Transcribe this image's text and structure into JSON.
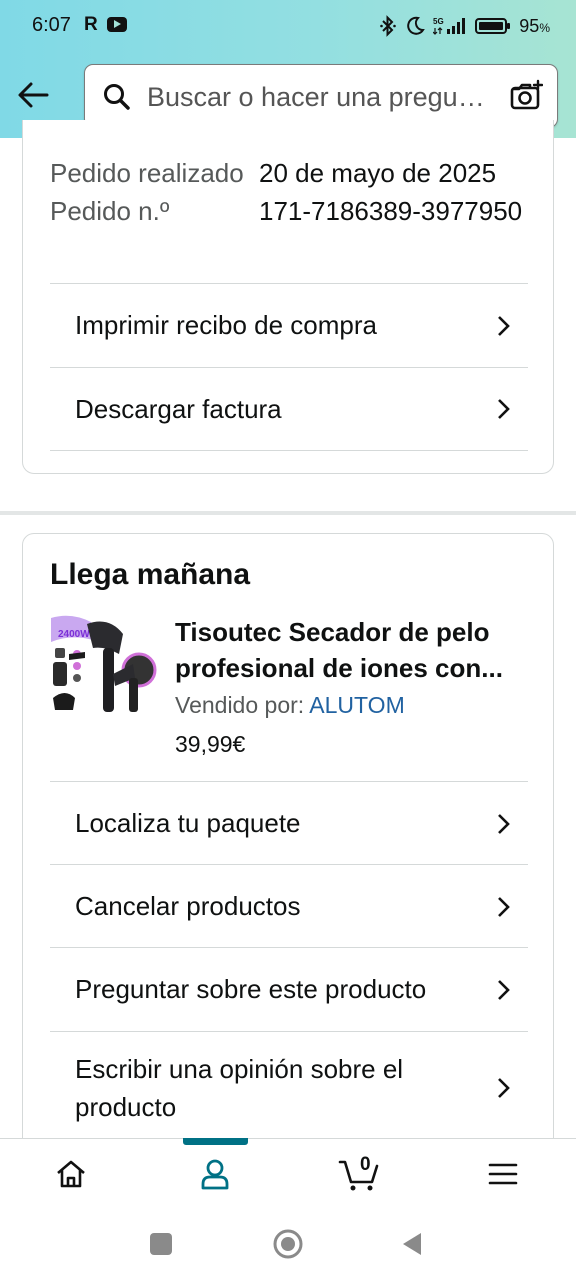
{
  "status_bar": {
    "time": "6:07",
    "carrier_icon": "R",
    "network": "5G",
    "battery_pct": "95",
    "battery_unit": "%"
  },
  "search": {
    "placeholder": "Buscar o hacer una pregunta"
  },
  "order": {
    "placed_label": "Pedido realizado",
    "placed_value": "20 de mayo de 2025",
    "number_label": "Pedido n.º",
    "number_value": "171-7186389-3977950",
    "actions": [
      "Imprimir recibo de compra",
      "Descargar factura"
    ]
  },
  "delivery": {
    "title": "Llega mañana",
    "product": {
      "name_line1": "Tisoutec Secador de pelo",
      "name_line2": "profesional de iones con...",
      "seller_label": "Vendido por:",
      "seller_name": "ALUTOM",
      "price": "39,99€",
      "image_text": "2400W"
    },
    "actions": [
      "Localiza tu paquete",
      "Cancelar productos",
      "Preguntar sobre este producto",
      "Escribir una opinión sobre el producto"
    ]
  },
  "bottom_nav": {
    "items": [
      "home-icon",
      "account-icon",
      "cart-icon",
      "menu-icon"
    ],
    "cart_count": "0",
    "active_index": 1
  },
  "colors": {
    "header_gradient_start": "#80d9e6",
    "header_gradient_end": "#a7e4d3",
    "link": "#2162a1",
    "active_nav": "#007185"
  }
}
